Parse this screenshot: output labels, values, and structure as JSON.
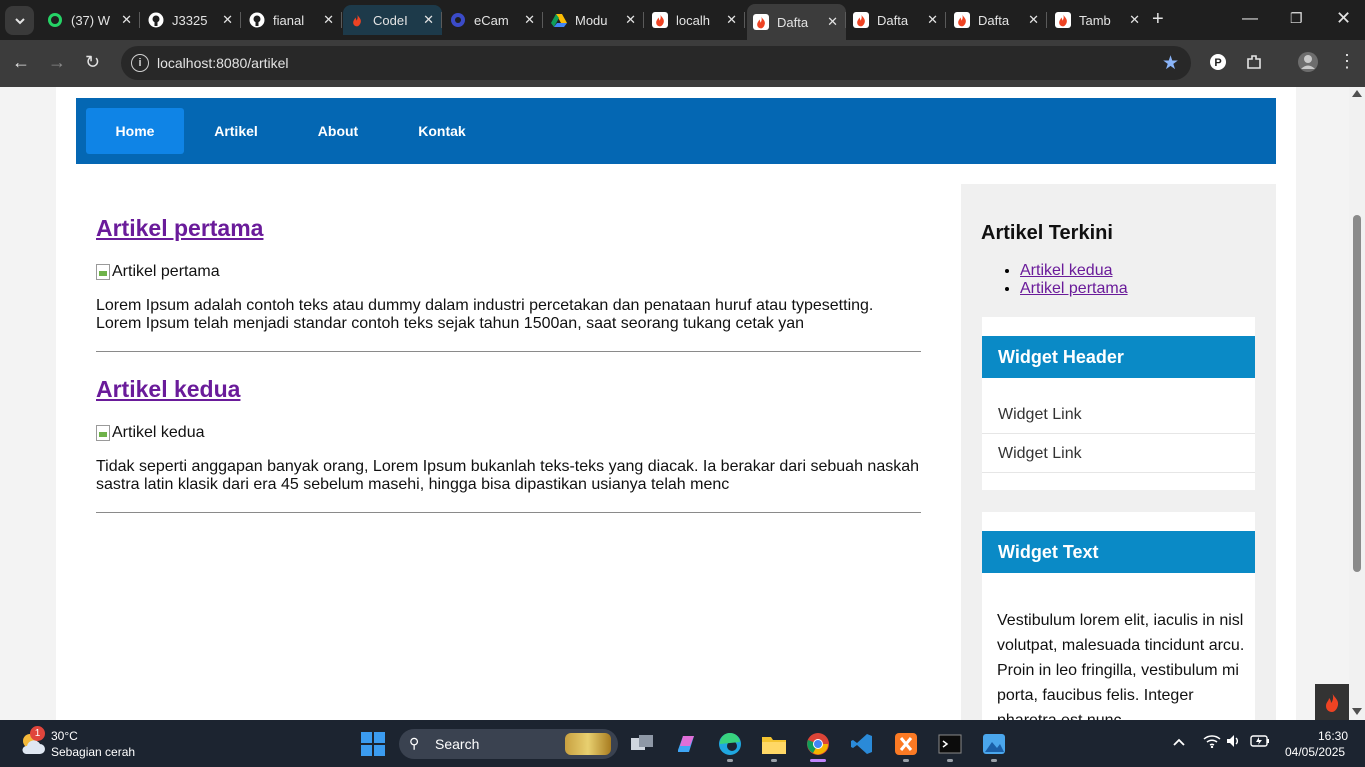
{
  "browser": {
    "tabs": [
      {
        "title": "(37) W",
        "icon": "whatsapp-icon",
        "color": "#25d366",
        "active": false
      },
      {
        "title": "J3325",
        "icon": "github-icon",
        "color": "#ffffff",
        "active": false
      },
      {
        "title": "fianal",
        "icon": "github-icon",
        "color": "#ffffff",
        "active": false
      },
      {
        "title": "CodeI",
        "icon": "codeigniter-icon",
        "color": "#ee4323",
        "active": false,
        "highlight": true
      },
      {
        "title": "eCam",
        "icon": "ecampus-icon",
        "color": "#3b4bc8",
        "active": false
      },
      {
        "title": "Modu",
        "icon": "google-drive-icon",
        "color": "#fbbc04",
        "active": false
      },
      {
        "title": "localh",
        "icon": "codeigniter-icon",
        "color": "#ee4323",
        "active": false
      },
      {
        "title": "Dafta",
        "icon": "codeigniter-icon",
        "color": "#ee4323",
        "active": true
      },
      {
        "title": "Dafta",
        "icon": "codeigniter-icon",
        "color": "#ee4323",
        "active": false
      },
      {
        "title": "Dafta",
        "icon": "codeigniter-icon",
        "color": "#ee4323",
        "active": false
      },
      {
        "title": "Tamb",
        "icon": "codeigniter-icon",
        "color": "#ee4323",
        "active": false
      }
    ],
    "url": "localhost:8080/artikel"
  },
  "site": {
    "nav": [
      {
        "label": "Home",
        "active": true
      },
      {
        "label": "Artikel",
        "active": false
      },
      {
        "label": "About",
        "active": false
      },
      {
        "label": "Kontak",
        "active": false
      }
    ],
    "articles": [
      {
        "title": "Artikel pertama",
        "image_alt": "Artikel pertama",
        "excerpt": "Lorem Ipsum adalah contoh teks atau dummy dalam industri percetakan dan penataan huruf atau typesetting. Lorem Ipsum telah menjadi standar contoh teks sejak tahun 1500an, saat seorang tukang cetak yan"
      },
      {
        "title": "Artikel kedua",
        "image_alt": "Artikel kedua",
        "excerpt": "Tidak seperti anggapan banyak orang, Lorem Ipsum bukanlah teks-teks yang diacak. Ia berakar dari sebuah naskah sastra latin klasik dari era 45 sebelum masehi, hingga bisa dipastikan usianya telah menc"
      }
    ],
    "sidebar": {
      "recent_title": "Artikel Terkini",
      "recent_links": [
        "Artikel kedua",
        "Artikel pertama"
      ],
      "widget1": {
        "header": "Widget Header",
        "links": [
          "Widget Link",
          "Widget Link"
        ]
      },
      "widget2": {
        "header": "Widget Text",
        "text": "Vestibulum lorem elit, iaculis in nisl volutpat, malesuada tincidunt arcu. Proin in leo fringilla, vestibulum mi porta, faucibus felis. Integer pharetra est nunc"
      }
    },
    "colors": {
      "nav_bg": "#0467b3",
      "nav_active": "#0f84e6",
      "widget_header": "#0a8ac6",
      "link_visited": "#6a1b9a"
    }
  },
  "taskbar": {
    "weather_temp": "30°C",
    "weather_desc": "Sebagian cerah",
    "weather_badge": "1",
    "search_label": "Search",
    "time": "16:30",
    "date": "04/05/2025"
  }
}
